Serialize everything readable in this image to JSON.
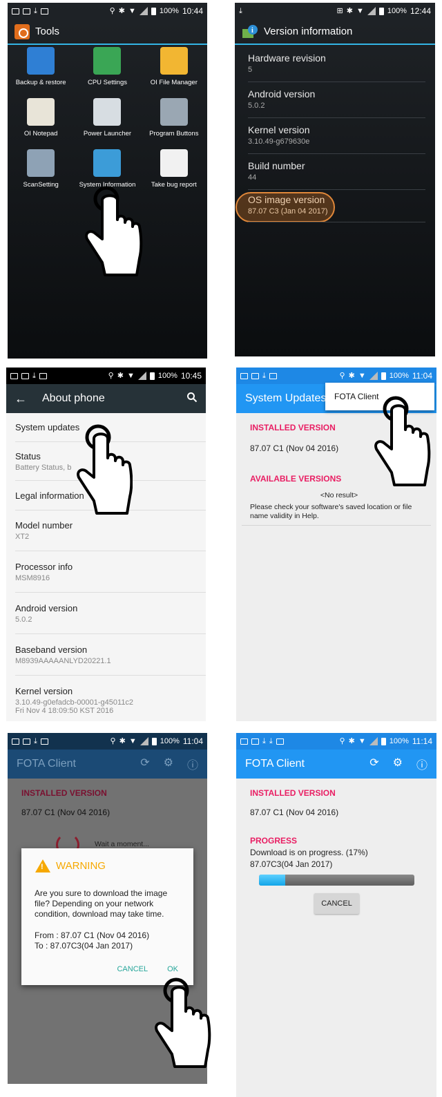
{
  "panel1": {
    "status": {
      "battery": "100%",
      "time": "10:44"
    },
    "title": "Tools",
    "apps": [
      {
        "label": "Backup & restore",
        "color": "#2f7fd4"
      },
      {
        "label": "CPU Settings",
        "color": "#3aa655"
      },
      {
        "label": "OI File Manager",
        "color": "#f2b632"
      },
      {
        "label": "OI Notepad",
        "color": "#e8e4d8"
      },
      {
        "label": "Power Launcher",
        "color": "#d7dde2"
      },
      {
        "label": "Program Buttons",
        "color": "#9aa7b3"
      },
      {
        "label": "ScanSetting",
        "color": "#8ea2b5"
      },
      {
        "label": "System Information",
        "color": "#3c9cd8"
      },
      {
        "label": "Take bug report",
        "color": "#f1f1f1"
      }
    ]
  },
  "panel2": {
    "status": {
      "battery": "100%",
      "time": "12:44"
    },
    "title": "Version information",
    "items": [
      {
        "title": "Hardware revision",
        "value": "5"
      },
      {
        "title": "Android version",
        "value": "5.0.2"
      },
      {
        "title": "Kernel version",
        "value": "3.10.49-g679630e"
      },
      {
        "title": "Build number",
        "value": "44"
      },
      {
        "title": "OS image version",
        "value": "87.07 C3 (Jan 04 2017)"
      }
    ]
  },
  "panel3": {
    "status": {
      "battery": "100%",
      "time": "10:45"
    },
    "title": "About phone",
    "items": [
      {
        "title": "System updates",
        "value": ""
      },
      {
        "title": "Status",
        "value": "Battery Status, b"
      },
      {
        "title": "Legal information",
        "value": ""
      },
      {
        "title": "Model number",
        "value": "XT2"
      },
      {
        "title": "Processor info",
        "value": "MSM8916"
      },
      {
        "title": "Android version",
        "value": "5.0.2"
      },
      {
        "title": "Baseband version",
        "value": "M8939AAAAANLYD20221.1"
      },
      {
        "title": "Kernel version",
        "value": "3.10.49-g0efadcb-00001-g45011c2\nFri Nov 4 18:09:50 KST 2016"
      }
    ]
  },
  "panel4": {
    "status": {
      "battery": "100%",
      "time": "11:04"
    },
    "title": "System Updates",
    "menu_item": "FOTA Client",
    "installed_heading": "INSTALLED VERSION",
    "installed_value": "87.07 C1 (Nov 04 2016)",
    "available_heading": "AVAILABLE VERSIONS",
    "no_result": "<No result>",
    "help_text": "Please check your software's saved location or file name validity in Help."
  },
  "panel5": {
    "status": {
      "battery": "100%",
      "time": "11:04"
    },
    "title": "FOTA Client",
    "installed_heading": "INSTALLED VERSION",
    "installed_value": "87.07 C1 (Nov 04 2016)",
    "wait_text": "Wait a moment...",
    "dialog": {
      "title": "WARNING",
      "message": "Are you sure to download the image file? Depending on your network condition, download may take time.",
      "from": "From : 87.07 C1 (Nov 04 2016)",
      "to": "To : 87.07C3(04 Jan 2017)",
      "cancel": "CANCEL",
      "ok": "OK"
    }
  },
  "panel6": {
    "status": {
      "battery": "100%",
      "time": "11:14"
    },
    "title": "FOTA Client",
    "installed_heading": "INSTALLED VERSION",
    "installed_value": "87.07 C1 (Nov 04 2016)",
    "progress_heading": "PROGRESS",
    "progress_text": "Download is on progress. (17%)",
    "progress_version": "87.07C3(04 Jan 2017)",
    "progress_percent": 17,
    "cancel": "CANCEL"
  },
  "colors": {
    "accent_blue": "#2196f3",
    "section_pink": "#e91e63",
    "warning": "#f6a800",
    "dialog_button": "#26a69a",
    "highlight": "#e0883a"
  }
}
